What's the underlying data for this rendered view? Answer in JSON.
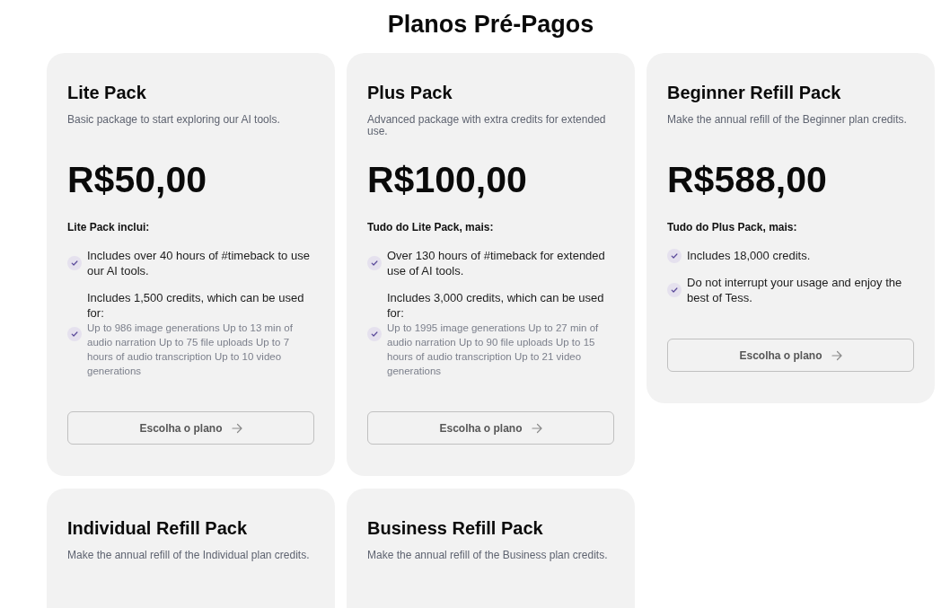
{
  "title": "Planos Pré-Pagos",
  "plans": [
    {
      "name": "Lite Pack",
      "description": "Basic package to start exploring our AI tools.",
      "price": "R$50,00",
      "includes_heading": "Lite Pack inclui:",
      "features": [
        {
          "text": "Includes over 40 hours of #timeback to use our AI tools."
        },
        {
          "text": "Includes 1,500 credits, which can be used for:",
          "details": "Up to 986 image generations Up to 13 min of audio narration Up to 75 file uploads Up to 7 hours of audio transcription Up to 10 video generations"
        }
      ],
      "button": "Escolha o plano"
    },
    {
      "name": "Plus Pack",
      "description": "Advanced package with extra credits for extended use.",
      "price": "R$100,00",
      "includes_heading": "Tudo do Lite Pack, mais:",
      "features": [
        {
          "text": "Over 130 hours of #timeback for extended use of AI tools."
        },
        {
          "text": "Includes 3,000 credits, which can be used for:",
          "details": "Up to 1995 image generations Up to 27 min of audio narration Up to 90 file uploads Up to 15 hours of audio transcription Up to 21 video generations"
        }
      ],
      "button": "Escolha o plano"
    },
    {
      "name": "Beginner Refill Pack",
      "description": "Make the annual refill of the Beginner plan credits.",
      "price": "R$588,00",
      "includes_heading": "Tudo do Plus Pack, mais:",
      "features": [
        {
          "text": "Includes 18,000 credits."
        },
        {
          "text": "Do not interrupt your usage and enjoy the best of Tess."
        }
      ],
      "button": "Escolha o plano"
    },
    {
      "name": "Individual Refill Pack",
      "description": "Make the annual refill of the Individual plan credits."
    },
    {
      "name": "Business Refill Pack",
      "description": "Make the annual refill of the Business plan credits."
    }
  ]
}
